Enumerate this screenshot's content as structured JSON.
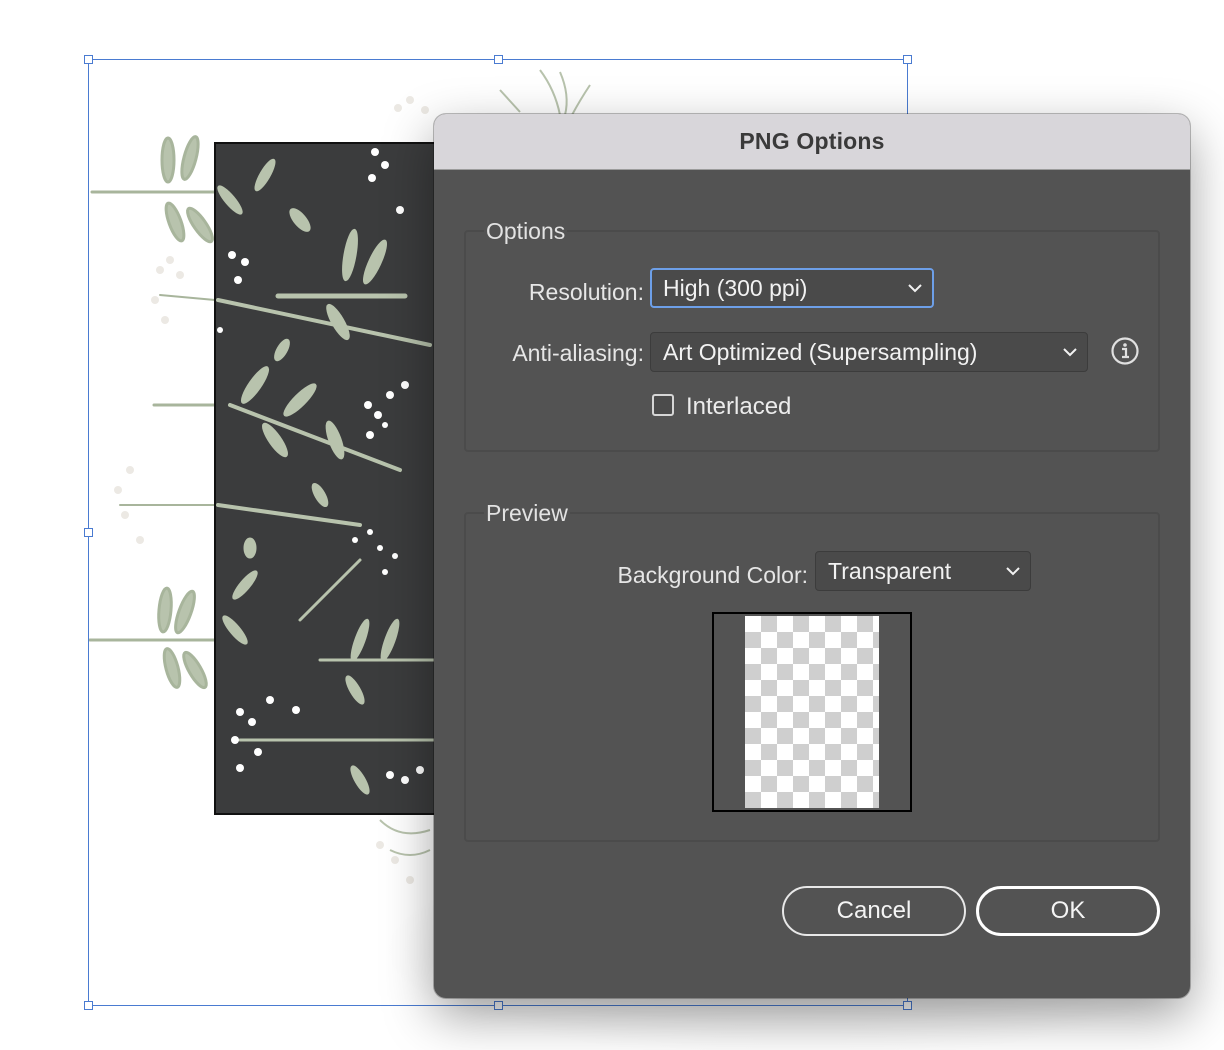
{
  "dialog": {
    "title": "PNG Options",
    "options_group": {
      "legend": "Options",
      "resolution": {
        "label": "Resolution:",
        "value": "High (300 ppi)",
        "icon": "chevron-down-icon"
      },
      "anti_aliasing": {
        "label": "Anti-aliasing:",
        "value": "Art Optimized (Supersampling)",
        "icon": "chevron-down-icon",
        "info_icon": "info-icon"
      },
      "interlaced": {
        "label": "Interlaced",
        "checked": false
      }
    },
    "preview_group": {
      "legend": "Preview",
      "background_color": {
        "label": "Background Color:",
        "value": "Transparent",
        "icon": "chevron-down-icon"
      }
    },
    "buttons": {
      "cancel": "Cancel",
      "ok": "OK"
    }
  },
  "colors": {
    "dialog_bg": "#535353",
    "titlebar_bg": "#d8d6da",
    "focus_ring": "#6d9fe8",
    "selection_box": "#4a7bd1",
    "art_background": "#3b3c3d",
    "leaf_color": "#b8c3ad",
    "berry_color": "#ffffff"
  }
}
